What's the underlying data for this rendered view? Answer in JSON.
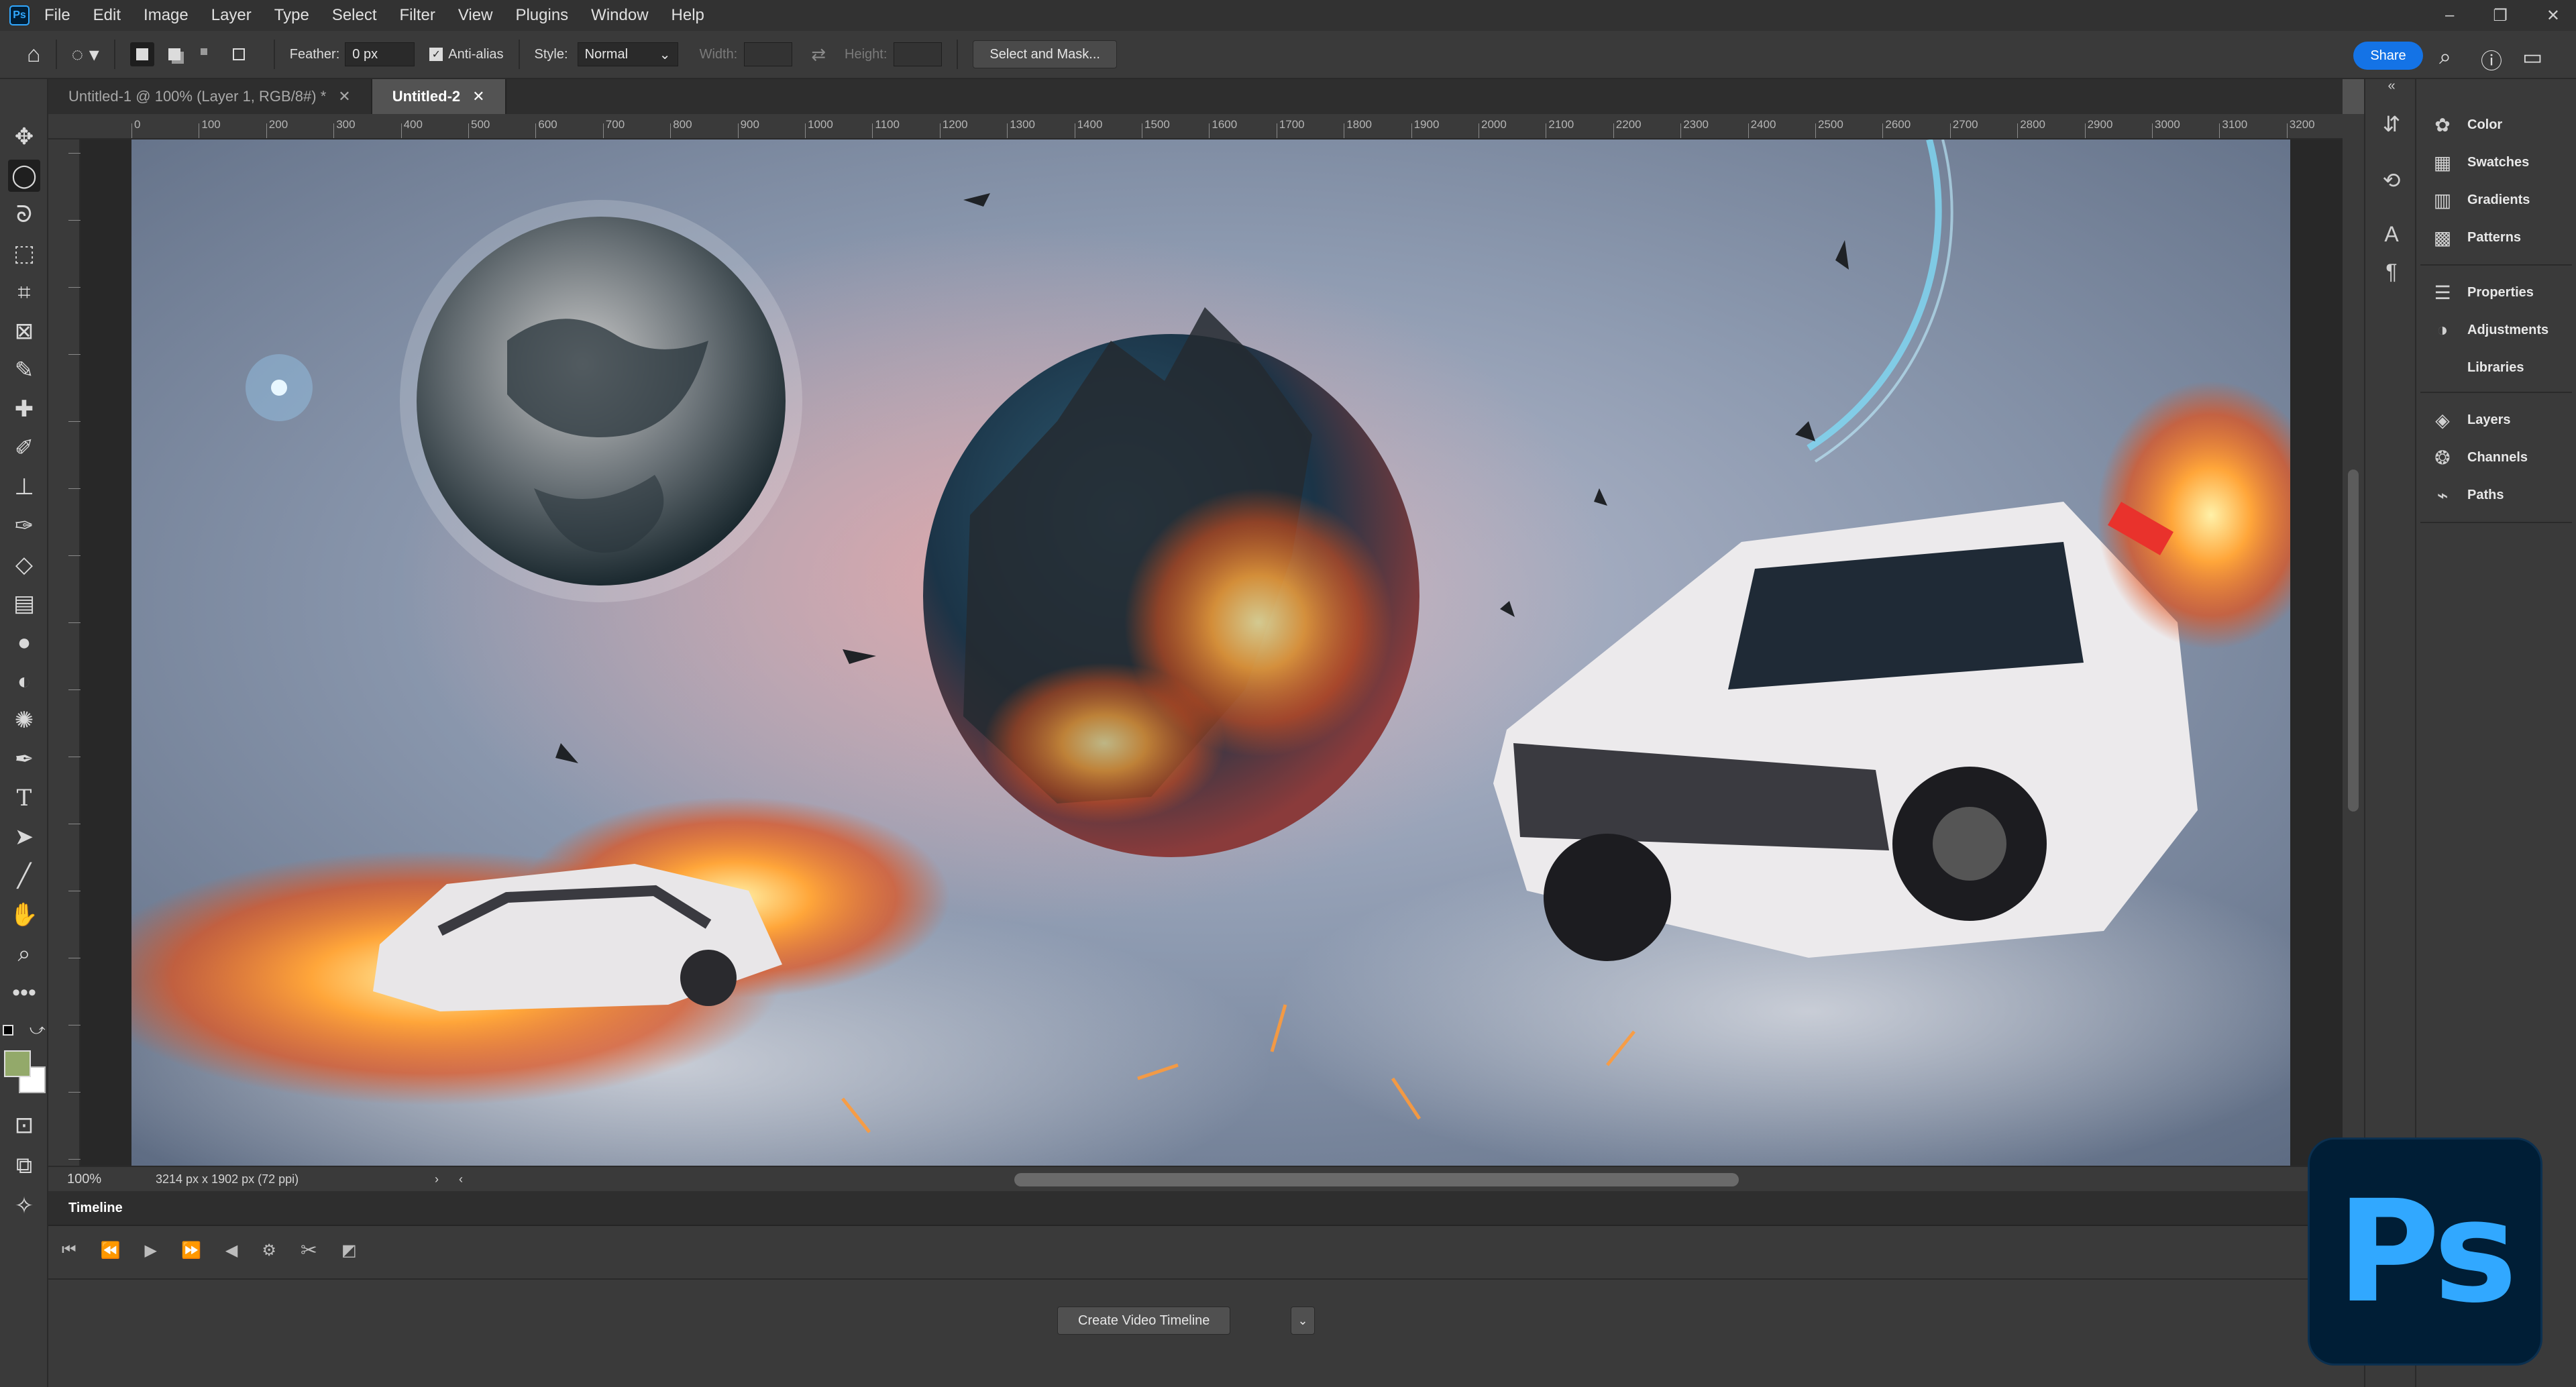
{
  "menubar": {
    "app_badge": "Ps",
    "items": [
      "File",
      "Edit",
      "Image",
      "Layer",
      "Type",
      "Select",
      "Filter",
      "View",
      "Plugins",
      "Window",
      "Help"
    ],
    "window_controls": [
      "–",
      "❐",
      "✕"
    ]
  },
  "options": {
    "feather_label": "Feather:",
    "feather_value": "0 px",
    "antialias_label": "Anti-alias",
    "antialias_checked": true,
    "style_label": "Style:",
    "style_value": "Normal",
    "width_label": "Width:",
    "height_label": "Height:",
    "select_mask_label": "Select and Mask...",
    "share_label": "Share"
  },
  "tabs": [
    {
      "label": "Untitled-1 @ 100% (Layer 1, RGB/8#) *",
      "active": false
    },
    {
      "label": "Untitled-2",
      "active": true
    }
  ],
  "ruler_top_labels": [
    "0",
    "100",
    "200",
    "300",
    "400",
    "500",
    "600",
    "700",
    "800",
    "900",
    "1000",
    "1100",
    "1200",
    "1300",
    "1400",
    "1500",
    "1600",
    "1700",
    "1800",
    "1900",
    "2000",
    "2100",
    "2200",
    "2300",
    "2400",
    "2500",
    "2600",
    "2700",
    "2800",
    "2900",
    "3000",
    "3100",
    "3200"
  ],
  "status": {
    "zoom": "100%",
    "doc_size": "3214 px x 1902 px (72 ppi)"
  },
  "timeline": {
    "title": "Timeline",
    "create_label": "Create Video Timeline"
  },
  "panels": [
    {
      "label": "Color",
      "icon": "color-wheel-icon"
    },
    {
      "label": "Swatches",
      "icon": "swatches-grid-icon"
    },
    {
      "label": "Gradients",
      "icon": "gradient-icon"
    },
    {
      "label": "Patterns",
      "icon": "patterns-icon"
    },
    {
      "label": "Properties",
      "icon": "properties-icon"
    },
    {
      "label": "Adjustments",
      "icon": "adjustments-icon"
    },
    {
      "label": "Libraries",
      "icon": "libraries-icon"
    },
    {
      "label": "Layers",
      "icon": "layers-icon"
    },
    {
      "label": "Channels",
      "icon": "channels-icon"
    },
    {
      "label": "Paths",
      "icon": "paths-icon"
    }
  ],
  "colors": {
    "foreground": "#93a96a",
    "background": "#ffffff",
    "accent": "#1473e6",
    "ps_blue": "#31a8ff",
    "ps_navy": "#001e36"
  },
  "logo": {
    "text": "Ps"
  }
}
